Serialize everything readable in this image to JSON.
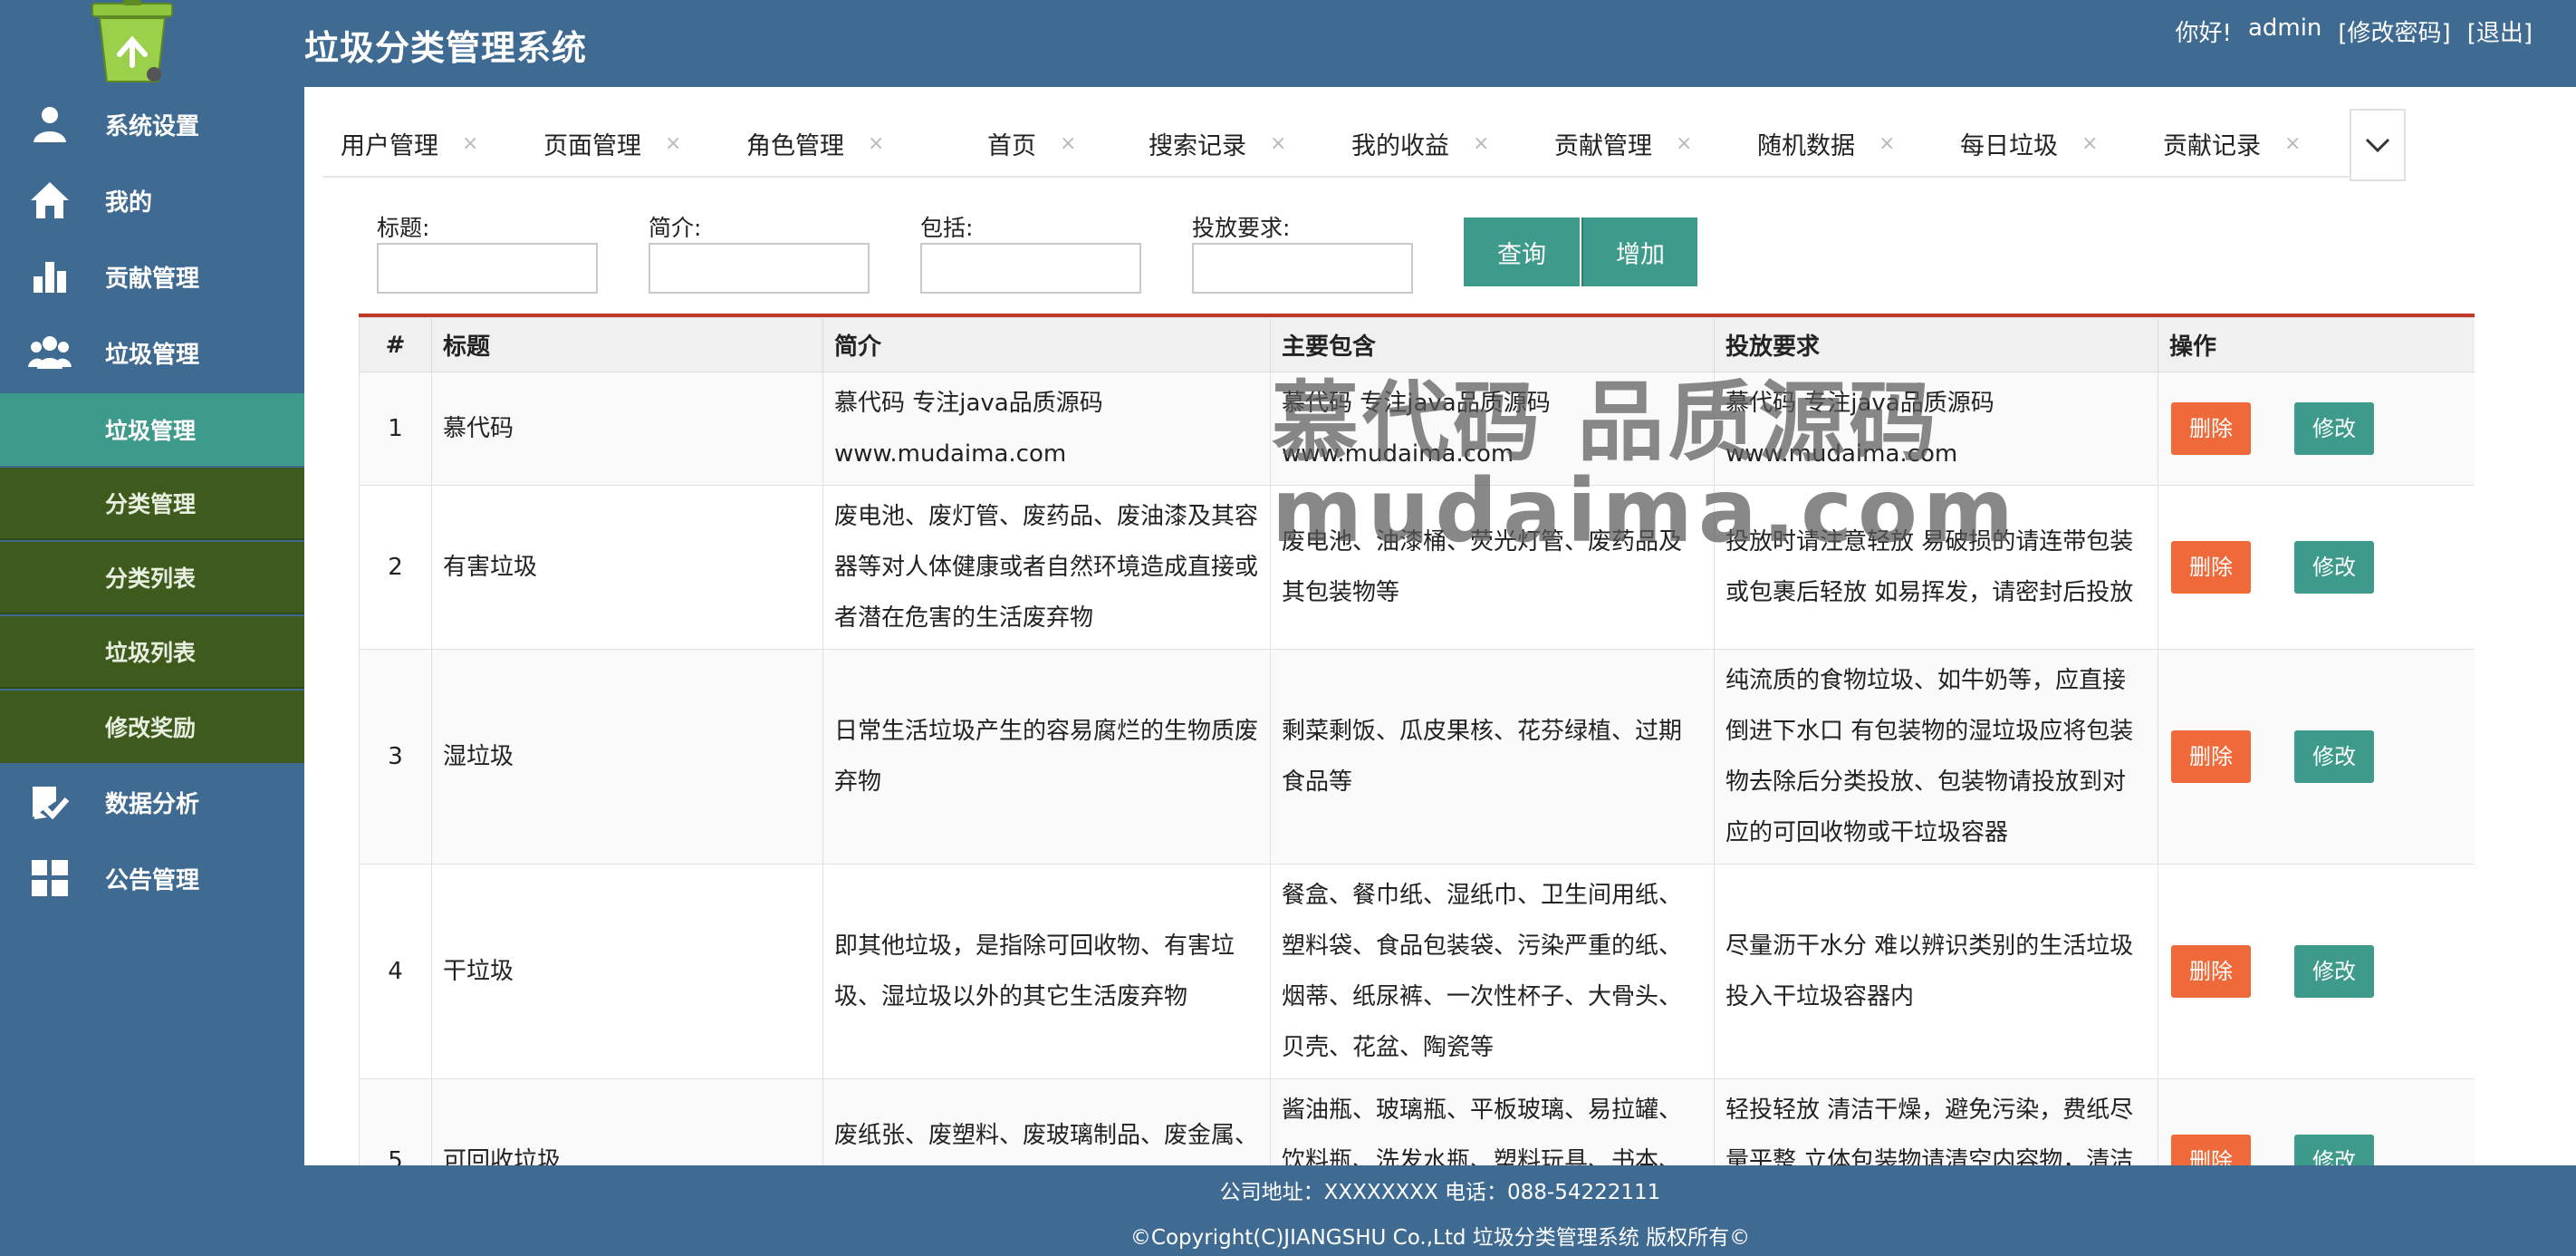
{
  "app": {
    "title": "垃圾分类管理系统"
  },
  "user": {
    "greeting": "你好!",
    "name": "admin",
    "change_password": "[修改密码]",
    "logout": "[退出]"
  },
  "sidebar": {
    "items": [
      {
        "label": "系统设置",
        "icon": "user-gear-icon"
      },
      {
        "label": "我的",
        "icon": "home-icon"
      },
      {
        "label": "贡献管理",
        "icon": "bar-chart-icon"
      },
      {
        "label": "垃圾管理",
        "icon": "group-icon"
      },
      {
        "label": "数据分析",
        "icon": "chart-check-icon"
      },
      {
        "label": "公告管理",
        "icon": "grid-icon"
      }
    ],
    "sub_items": [
      {
        "label": "垃圾管理",
        "active": true
      },
      {
        "label": "分类管理",
        "active": false
      },
      {
        "label": "分类列表",
        "active": false
      },
      {
        "label": "垃圾列表",
        "active": false
      },
      {
        "label": "修改奖励",
        "active": false
      }
    ]
  },
  "tabs": [
    {
      "label": "用户管理"
    },
    {
      "label": "页面管理"
    },
    {
      "label": "角色管理"
    },
    {
      "label": "首页"
    },
    {
      "label": "搜索记录"
    },
    {
      "label": "我的收益"
    },
    {
      "label": "贡献管理"
    },
    {
      "label": "随机数据"
    },
    {
      "label": "每日垃圾"
    },
    {
      "label": "贡献记录"
    }
  ],
  "tab_close_glyph": "×",
  "search": {
    "title_label": "标题:",
    "intro_label": "简介:",
    "include_label": "包括:",
    "requirement_label": "投放要求:",
    "title_value": "",
    "intro_value": "",
    "include_value": "",
    "requirement_value": "",
    "query_button": "查询",
    "add_button": "增加"
  },
  "table": {
    "headers": [
      "#",
      "标题",
      "简介",
      "主要包含",
      "投放要求",
      "操作"
    ],
    "delete_label": "删除",
    "edit_label": "修改",
    "rows": [
      {
        "num": "1",
        "title": "慕代码",
        "intro": "慕代码 专注java品质源码 www.mudaima.com",
        "contains": "慕代码 专注java品质源码 www.mudaima.com",
        "requirement": "慕代码 专注java品质源码 www.mudaima.com"
      },
      {
        "num": "2",
        "title": "有害垃圾",
        "intro": "废电池、废灯管、废药品、废油漆及其容器等对人体健康或者自然环境造成直接或者潜在危害的生活废弃物",
        "contains": "废电池、油漆桶、荧光灯管、废药品及其包装物等",
        "requirement": "投放时请注意轻放 易破损的请连带包装或包裹后轻放 如易挥发，请密封后投放"
      },
      {
        "num": "3",
        "title": "湿垃圾",
        "intro": "日常生活垃圾产生的容易腐烂的生物质废弃物",
        "contains": "剩菜剩饭、瓜皮果核、花芬绿植、过期食品等",
        "requirement": "纯流质的食物垃圾、如牛奶等，应直接倒进下水口 有包装物的湿垃圾应将包装物去除后分类投放、包装物请投放到对应的可回收物或干垃圾容器"
      },
      {
        "num": "4",
        "title": "干垃圾",
        "intro": "即其他垃圾，是指除可回收物、有害垃圾、湿垃圾以外的其它生活废弃物",
        "contains": "餐盒、餐巾纸、湿纸巾、卫生间用纸、塑料袋、食品包装袋、污染严重的纸、烟蒂、纸尿裤、一次性杯子、大骨头、贝壳、花盆、陶瓷等",
        "requirement": "尽量沥干水分 难以辨识类别的生活垃圾投入干垃圾容器内"
      },
      {
        "num": "5",
        "title": "可回收垃圾",
        "intro": "废纸张、废塑料、废玻璃制品、废金属、废织物等适宜回收、可循环利用",
        "contains": "酱油瓶、玻璃瓶、平板玻璃、易拉罐、饮料瓶、洗发水瓶、塑料玩具、书本、报纸、广告单、纸板箱、衣",
        "requirement": "轻投轻放 清洁干燥，避免污染，费纸尽量平整 立体包装物请清空内容物，清洁后压扁投放 有尖锐边角的，应包"
      }
    ]
  },
  "watermark": {
    "line1": "慕代码 品质源码",
    "line2": "mudaima.com"
  },
  "footer": {
    "address": "公司地址：XXXXXXXX 电话：088-54222111",
    "copyright": "©Copyright(C)JIANGSHU Co.,Ltd 垃圾分类管理系统 版权所有©"
  },
  "colors": {
    "sidebar_bg": "#3f6a91",
    "submenu_bg": "#3e5a1c",
    "active_teal": "#3e9a8a",
    "delete_orange": "#ee6a3a",
    "table_top_border": "#c0392b"
  }
}
